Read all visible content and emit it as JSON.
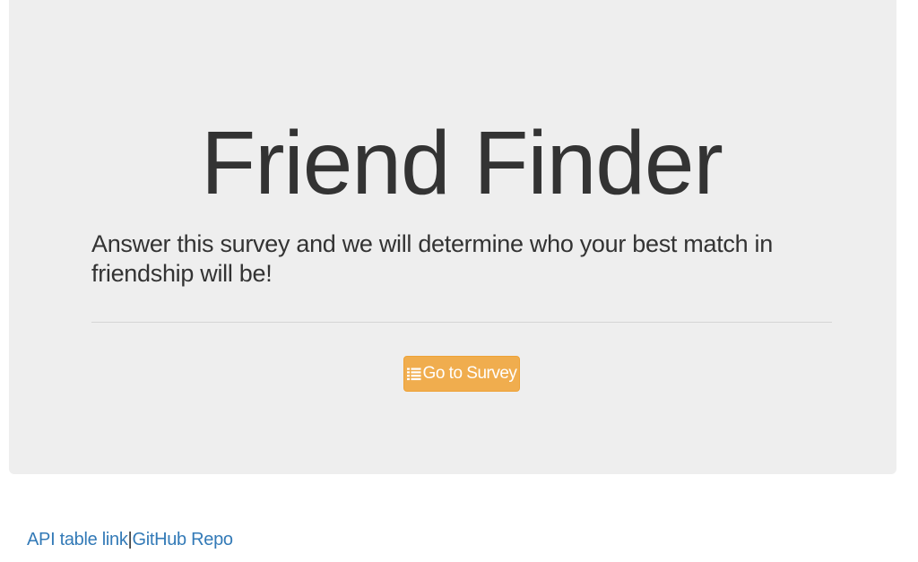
{
  "jumbotron": {
    "title": "Friend Finder",
    "lead": "Answer this survey and we will determine who your best match in friendship will be!",
    "button": {
      "icon": "list-icon",
      "label": "Go to Survey",
      "color": "#f0ad4e"
    }
  },
  "footer": {
    "api_link": "API table link",
    "separator": "|",
    "github_link": "GitHub Repo",
    "link_color": "#337ab7"
  }
}
